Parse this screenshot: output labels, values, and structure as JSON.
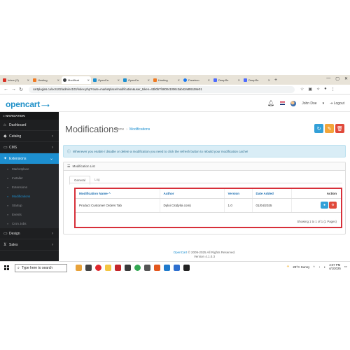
{
  "browser": {
    "tabs": [
      {
        "label": "Inbox (2)",
        "color": "#d93025",
        "active": false
      },
      {
        "label": "Hosting",
        "color": "#f17a22",
        "active": false
      },
      {
        "label": "Modificat",
        "color": "#3c4043",
        "active": true
      },
      {
        "label": "OpenCa",
        "color": "#1d8fd0",
        "active": false
      },
      {
        "label": "OpenCa",
        "color": "#1d8fd0",
        "active": false
      },
      {
        "label": "Hosting",
        "color": "#f17a22",
        "active": false
      },
      {
        "label": "Faceboo",
        "color": "#1877f2",
        "active": false
      },
      {
        "label": "DeepSe",
        "color": "#4d6bfe",
        "active": false
      },
      {
        "label": "DeepSe",
        "color": "#4d6bfe",
        "active": false
      }
    ],
    "url": "cartplugins.ca/oc4102/admin4103/index.php?route=marketplace/modification&user_token=43b0b7f480041006c3ab42a855108e01"
  },
  "header": {
    "logo": "opencart",
    "user_name": "John Doe",
    "logout": "Logout"
  },
  "sidebar": {
    "heading": "NAVIGATION",
    "items": [
      {
        "label": "Dashboard"
      },
      {
        "label": "Catalog"
      },
      {
        "label": "CMS"
      },
      {
        "label": "Extensions"
      }
    ],
    "sub_items": [
      {
        "label": "Marketplace"
      },
      {
        "label": "Installer"
      },
      {
        "label": "Extensions"
      },
      {
        "label": "Modifications"
      },
      {
        "label": "Startup"
      },
      {
        "label": "Events"
      },
      {
        "label": "Cron Jobs"
      }
    ],
    "items_after": [
      {
        "label": "Design"
      },
      {
        "label": "Sales"
      }
    ]
  },
  "main": {
    "title": "Modifications",
    "breadcrumb": [
      "Home",
      "Modifications"
    ],
    "alert": "Whenever you enable / disable or delete a modification you need to click the refresh button to rebuild your modification cache!",
    "panel_title": "Modification List",
    "tabs": [
      "General",
      "Log"
    ],
    "table": {
      "headers": [
        "Modification Name ^",
        "Author",
        "Version",
        "Date Added",
        "Action"
      ],
      "rows": [
        {
          "name": "Product Customer Orders Tab",
          "author": "Dyloi Cstdyloi.com)",
          "version": "1.0",
          "date": "01/04/2025"
        }
      ]
    },
    "pagination": "Showing 1 to 1 of 1 (1 Pages)",
    "footer_link": "OpenCart",
    "footer_copy": "© 2009-2025 All Rights Reserved.",
    "footer_version": "Version 4.1.0.3"
  },
  "taskbar": {
    "search_placeholder": "Type here to search",
    "weather": "29°C  Sunny",
    "time": "2:07 PM",
    "date": "4/1/2025"
  }
}
